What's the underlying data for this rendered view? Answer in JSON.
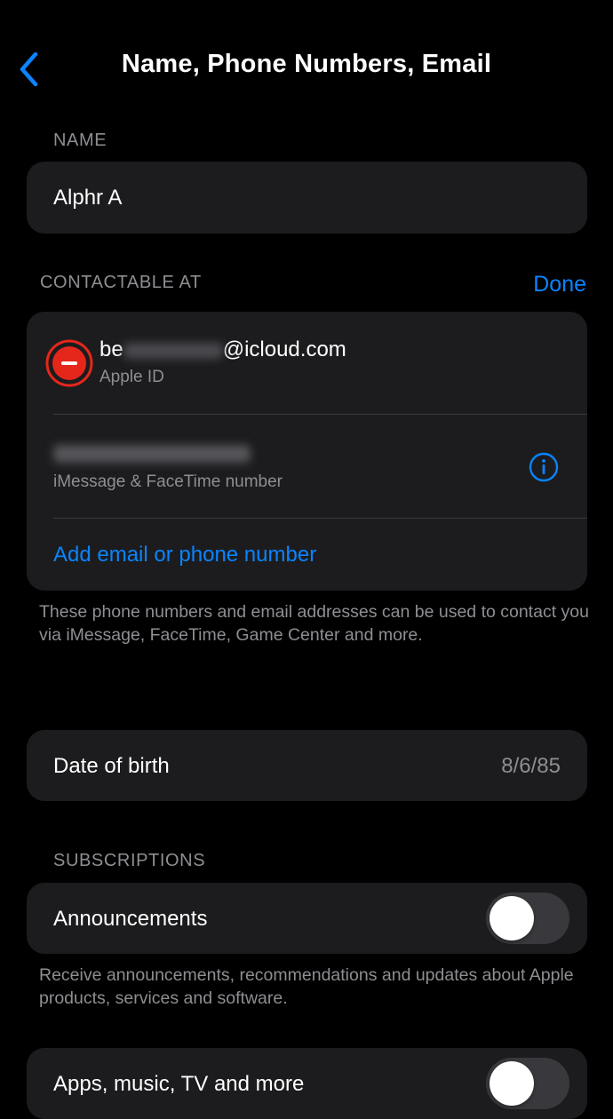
{
  "header": {
    "title": "Name, Phone Numbers, Email",
    "back_icon": "chevron-left-icon"
  },
  "name_section": {
    "label": "NAME",
    "value": "Alphr A"
  },
  "contact_section": {
    "label": "CONTACTABLE AT",
    "done_label": "Done",
    "email": {
      "prefix": "be",
      "suffix": "@icloud.com",
      "sublabel": "Apple ID"
    },
    "phone": {
      "sublabel": "iMessage & FaceTime number"
    },
    "add_label": "Add email or phone number",
    "footer": "These phone numbers and email addresses can be used to contact you via iMessage, FaceTime, Game Center and more."
  },
  "dob": {
    "label": "Date of birth",
    "value": "8/6/85"
  },
  "subscriptions": {
    "label": "SUBSCRIPTIONS",
    "announcements_label": "Announcements",
    "announcements_on": false,
    "footer": "Receive announcements, recommendations and updates about Apple products, services and software.",
    "apps_label": "Apps, music, TV and more",
    "apps_on": false
  },
  "colors": {
    "accent": "#0a84ff",
    "delete": "#e5271b",
    "card": "#1c1c1e",
    "background": "#000000"
  }
}
